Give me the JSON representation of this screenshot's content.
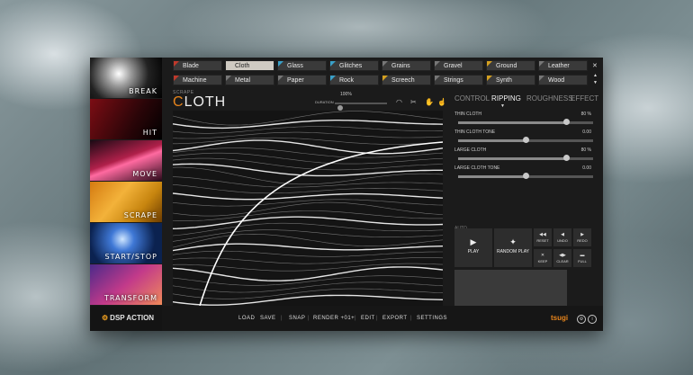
{
  "categories": [
    {
      "label": "BREAK"
    },
    {
      "label": "HIT"
    },
    {
      "label": "MOVE"
    },
    {
      "label": "SCRAPE"
    },
    {
      "label": "START/STOP"
    },
    {
      "label": "TRANSFORM"
    }
  ],
  "brand": {
    "logo": "DSP ACTION",
    "tsugi": "tsugi"
  },
  "presets": [
    {
      "label": "Blade",
      "color": "#c0392b"
    },
    {
      "label": "Cloth",
      "color": "#cfcac2",
      "selected": true
    },
    {
      "label": "Glass",
      "color": "#3aa0c8"
    },
    {
      "label": "Glitches",
      "color": "#3aa0c8"
    },
    {
      "label": "Grains",
      "color": "#777777"
    },
    {
      "label": "Gravel",
      "color": "#777777"
    },
    {
      "label": "Ground",
      "color": "#d4a020"
    },
    {
      "label": "Leather",
      "color": "#777777"
    },
    {
      "label": "Machine",
      "color": "#c0392b"
    },
    {
      "label": "Metal",
      "color": "#777777"
    },
    {
      "label": "Paper",
      "color": "#777777"
    },
    {
      "label": "Rock",
      "color": "#3aa0c8"
    },
    {
      "label": "Screech",
      "color": "#d4a020"
    },
    {
      "label": "Strings",
      "color": "#777777"
    },
    {
      "label": "Synth",
      "color": "#d4a020"
    },
    {
      "label": "Wood",
      "color": "#777777"
    }
  ],
  "window": {
    "close": "✕",
    "scroll_up": "▲",
    "scroll_down": "▼"
  },
  "header": {
    "category": "SCRAPE",
    "title_first": "C",
    "title_rest": "LOTH"
  },
  "duration": {
    "label": "DURATION",
    "value": "100%",
    "level": 0.05
  },
  "tabs": [
    {
      "label": "CONTROL",
      "active": false
    },
    {
      "label": "RIPPING",
      "active": true
    },
    {
      "label": "ROUGHNESS",
      "active": false
    },
    {
      "label": "EFFECT",
      "active": false
    }
  ],
  "params": [
    {
      "label": "THIN CLOTH",
      "value": "80 %",
      "level": 0.8,
      "fill": 0.8
    },
    {
      "label": "THIN CLOTH TONE",
      "value": "0.00",
      "level": 0.5,
      "fill": 0.5
    },
    {
      "label": "LARGE CLOTH",
      "value": "80 %",
      "level": 0.8,
      "fill": 0.8
    },
    {
      "label": "LARGE CLOTH TONE",
      "value": "0.00",
      "level": 0.5,
      "fill": 0.5
    }
  ],
  "auto_label": "AUTO",
  "actions": {
    "play": "PLAY",
    "random_play": "RANDOM PLAY",
    "reset": "RESET",
    "undo": "UNDO",
    "redo": "REDO",
    "keep": "KEEP",
    "clear": "CLEAR",
    "full": "FULL"
  },
  "footer": {
    "load": "LOAD",
    "save": "SAVE",
    "snap": "SNAP",
    "render": "RENDER +01+",
    "edit": "EDIT",
    "export": "EXPORT",
    "settings": "SETTINGS",
    "sep": "|"
  },
  "icons": {
    "logo": "gear-icon",
    "play": "play-icon",
    "random": "random-icon",
    "reset": "reset-icon",
    "undo": "undo-icon",
    "redo": "redo-icon",
    "keep": "keep-icon",
    "clear": "clear-icon",
    "full": "full-icon"
  }
}
